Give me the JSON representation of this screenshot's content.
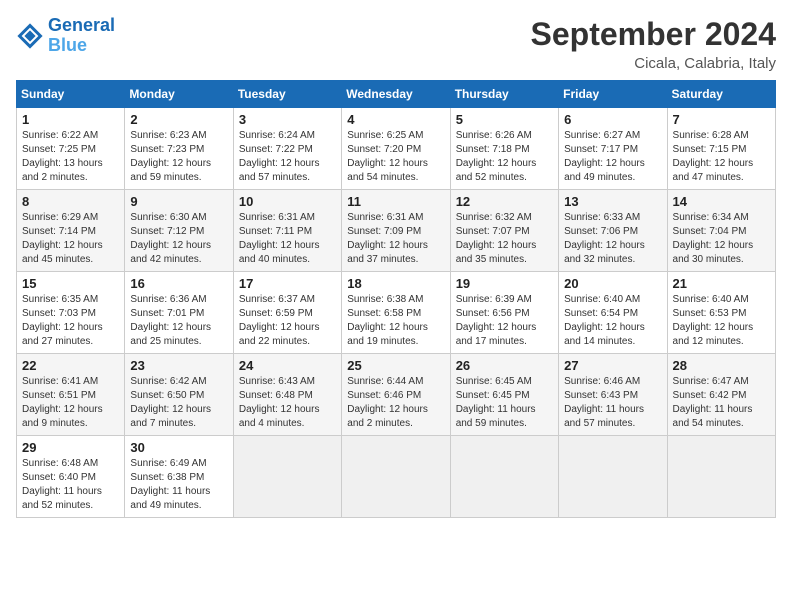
{
  "header": {
    "logo_line1": "General",
    "logo_line2": "Blue",
    "month": "September 2024",
    "location": "Cicala, Calabria, Italy"
  },
  "weekdays": [
    "Sunday",
    "Monday",
    "Tuesday",
    "Wednesday",
    "Thursday",
    "Friday",
    "Saturday"
  ],
  "weeks": [
    [
      {
        "day": 1,
        "detail": "Sunrise: 6:22 AM\nSunset: 7:25 PM\nDaylight: 13 hours\nand 2 minutes."
      },
      {
        "day": 2,
        "detail": "Sunrise: 6:23 AM\nSunset: 7:23 PM\nDaylight: 12 hours\nand 59 minutes."
      },
      {
        "day": 3,
        "detail": "Sunrise: 6:24 AM\nSunset: 7:22 PM\nDaylight: 12 hours\nand 57 minutes."
      },
      {
        "day": 4,
        "detail": "Sunrise: 6:25 AM\nSunset: 7:20 PM\nDaylight: 12 hours\nand 54 minutes."
      },
      {
        "day": 5,
        "detail": "Sunrise: 6:26 AM\nSunset: 7:18 PM\nDaylight: 12 hours\nand 52 minutes."
      },
      {
        "day": 6,
        "detail": "Sunrise: 6:27 AM\nSunset: 7:17 PM\nDaylight: 12 hours\nand 49 minutes."
      },
      {
        "day": 7,
        "detail": "Sunrise: 6:28 AM\nSunset: 7:15 PM\nDaylight: 12 hours\nand 47 minutes."
      }
    ],
    [
      {
        "day": 8,
        "detail": "Sunrise: 6:29 AM\nSunset: 7:14 PM\nDaylight: 12 hours\nand 45 minutes."
      },
      {
        "day": 9,
        "detail": "Sunrise: 6:30 AM\nSunset: 7:12 PM\nDaylight: 12 hours\nand 42 minutes."
      },
      {
        "day": 10,
        "detail": "Sunrise: 6:31 AM\nSunset: 7:11 PM\nDaylight: 12 hours\nand 40 minutes."
      },
      {
        "day": 11,
        "detail": "Sunrise: 6:31 AM\nSunset: 7:09 PM\nDaylight: 12 hours\nand 37 minutes."
      },
      {
        "day": 12,
        "detail": "Sunrise: 6:32 AM\nSunset: 7:07 PM\nDaylight: 12 hours\nand 35 minutes."
      },
      {
        "day": 13,
        "detail": "Sunrise: 6:33 AM\nSunset: 7:06 PM\nDaylight: 12 hours\nand 32 minutes."
      },
      {
        "day": 14,
        "detail": "Sunrise: 6:34 AM\nSunset: 7:04 PM\nDaylight: 12 hours\nand 30 minutes."
      }
    ],
    [
      {
        "day": 15,
        "detail": "Sunrise: 6:35 AM\nSunset: 7:03 PM\nDaylight: 12 hours\nand 27 minutes."
      },
      {
        "day": 16,
        "detail": "Sunrise: 6:36 AM\nSunset: 7:01 PM\nDaylight: 12 hours\nand 25 minutes."
      },
      {
        "day": 17,
        "detail": "Sunrise: 6:37 AM\nSunset: 6:59 PM\nDaylight: 12 hours\nand 22 minutes."
      },
      {
        "day": 18,
        "detail": "Sunrise: 6:38 AM\nSunset: 6:58 PM\nDaylight: 12 hours\nand 19 minutes."
      },
      {
        "day": 19,
        "detail": "Sunrise: 6:39 AM\nSunset: 6:56 PM\nDaylight: 12 hours\nand 17 minutes."
      },
      {
        "day": 20,
        "detail": "Sunrise: 6:40 AM\nSunset: 6:54 PM\nDaylight: 12 hours\nand 14 minutes."
      },
      {
        "day": 21,
        "detail": "Sunrise: 6:40 AM\nSunset: 6:53 PM\nDaylight: 12 hours\nand 12 minutes."
      }
    ],
    [
      {
        "day": 22,
        "detail": "Sunrise: 6:41 AM\nSunset: 6:51 PM\nDaylight: 12 hours\nand 9 minutes."
      },
      {
        "day": 23,
        "detail": "Sunrise: 6:42 AM\nSunset: 6:50 PM\nDaylight: 12 hours\nand 7 minutes."
      },
      {
        "day": 24,
        "detail": "Sunrise: 6:43 AM\nSunset: 6:48 PM\nDaylight: 12 hours\nand 4 minutes."
      },
      {
        "day": 25,
        "detail": "Sunrise: 6:44 AM\nSunset: 6:46 PM\nDaylight: 12 hours\nand 2 minutes."
      },
      {
        "day": 26,
        "detail": "Sunrise: 6:45 AM\nSunset: 6:45 PM\nDaylight: 11 hours\nand 59 minutes."
      },
      {
        "day": 27,
        "detail": "Sunrise: 6:46 AM\nSunset: 6:43 PM\nDaylight: 11 hours\nand 57 minutes."
      },
      {
        "day": 28,
        "detail": "Sunrise: 6:47 AM\nSunset: 6:42 PM\nDaylight: 11 hours\nand 54 minutes."
      }
    ],
    [
      {
        "day": 29,
        "detail": "Sunrise: 6:48 AM\nSunset: 6:40 PM\nDaylight: 11 hours\nand 52 minutes."
      },
      {
        "day": 30,
        "detail": "Sunrise: 6:49 AM\nSunset: 6:38 PM\nDaylight: 11 hours\nand 49 minutes."
      },
      null,
      null,
      null,
      null,
      null
    ]
  ]
}
